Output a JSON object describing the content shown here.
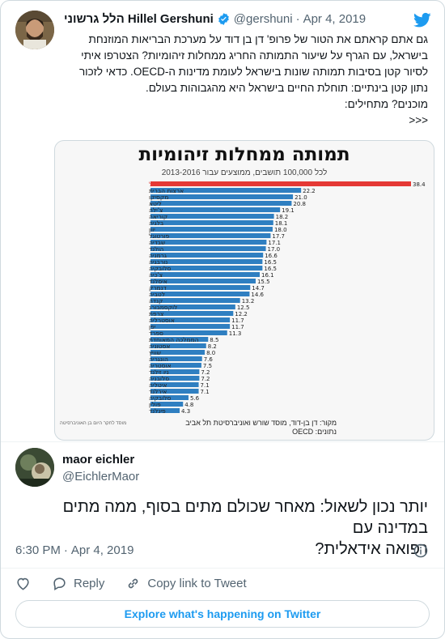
{
  "colors": {
    "accent": "#1d9bf0",
    "israel_bar": "#e53935",
    "bar": "#2f7fc1",
    "muted": "#536471"
  },
  "quoted_tweet": {
    "name": "הלל גרשוני Hillel Gershuni",
    "handle": "@gershuni",
    "separator": "·",
    "date": "Apr 4, 2019",
    "lines": [
      "גם אתם קראתם את הטור של פרופ' דן בן דוד על מערכת הבריאות המוזנחת",
      "בישראל, עם הגרף על שיעור התמותה החריג ממחלות זיהומיות? הצטרפו איתי",
      "לסיור קטן בסיבות תמותה שונות בישראל לעומת מדינות ה-OECD. כדאי לזכור",
      "נתון קטן בינתיים: תוחלת החיים בישראל היא מהגבוהות בעולם.",
      "מוכנים? מתחילים:",
      ">>>"
    ],
    "icons": [
      "verified-badge-icon",
      "twitter-bird-icon"
    ]
  },
  "chart_data": {
    "type": "bar",
    "orientation": "horizontal",
    "title": "תמותה ממחלות זיהומיות",
    "subtitle": "לכל 100,000 תושבים, ממוצעים עבור 2013-2016",
    "categories": [
      "ישראל",
      "ארצות הברית",
      "מקסיקו",
      "ליטא",
      "צ'ילה",
      "קוריאה",
      "בלגיה",
      "יוון",
      "פורטוגל",
      "שבדיה",
      "הולנד",
      "גרמניה",
      "נורבגיה",
      "סלובקיה",
      "צ'כיה",
      "איסלנד",
      "דנמרק",
      "לטביה",
      "קנדה",
      "לוקסמבורג",
      "צרפת",
      "אוסטרליה",
      "יפן",
      "ספרד",
      "הממלכה המאוחדת",
      "אסטוניה",
      "שוויץ",
      "הונגריה",
      "אוסטריה",
      "ניו זילנד",
      "סלובניה",
      "איטליה",
      "אירלנד",
      "סלובקיה",
      "פולין",
      "פינלנד"
    ],
    "values": [
      38.4,
      22.2,
      21.0,
      20.8,
      19.1,
      18.2,
      18.1,
      18.0,
      17.7,
      17.1,
      17.0,
      16.6,
      16.5,
      16.5,
      16.1,
      15.5,
      14.7,
      14.6,
      13.2,
      12.5,
      12.2,
      11.7,
      11.7,
      11.3,
      8.5,
      8.2,
      8.0,
      7.6,
      7.5,
      7.2,
      7.2,
      7.1,
      7.1,
      5.6,
      4.8,
      4.3
    ],
    "value_labels": [
      "38.4",
      "22.2",
      "21.0",
      "20.8",
      "19.1",
      "18.2",
      "18.1",
      "18.0",
      "17.7",
      "17.1",
      "17.0",
      "16.6",
      "16.5",
      "16.5",
      "16.1",
      "15.5",
      "14.7",
      "14.6",
      "13.2",
      "12.5",
      "12.2",
      "11.7",
      "11.7",
      "11.3",
      "8.5",
      "8.2",
      "8.0",
      "7.6",
      "7.5",
      "7.2",
      "7.2",
      "7.1",
      "7.1",
      "5.6",
      "4.8",
      "4.3"
    ],
    "highlight_index": 0,
    "xlim": [
      0,
      38.4
    ],
    "grid": false,
    "source_lines": [
      "מקור: דן בן-דוד, מוסד שורש ואוניברסיטת תל אביב",
      "נתונים: OECD"
    ],
    "logo_text": "מוסד לחקר היום בן האוניברסיטה"
  },
  "tweet": {
    "author_name": "maor eichler",
    "author_handle": "@EichlerMaor",
    "text_lines": [
      "יותר נכון לשאול: מאחר שכולם מתים בסוף, ממה מתים במדינה עם",
      "רפואה אידאלית?"
    ],
    "time": "6:30 PM",
    "separator": "·",
    "date": "Apr 4, 2019"
  },
  "actions": {
    "like_icon": "heart-icon",
    "reply_label": "Reply",
    "reply_icon": "speech-bubble-icon",
    "copy_label": "Copy link to Tweet",
    "copy_icon": "link-icon",
    "info_icon": "info-icon"
  },
  "explore_label": "Explore what's happening on Twitter"
}
